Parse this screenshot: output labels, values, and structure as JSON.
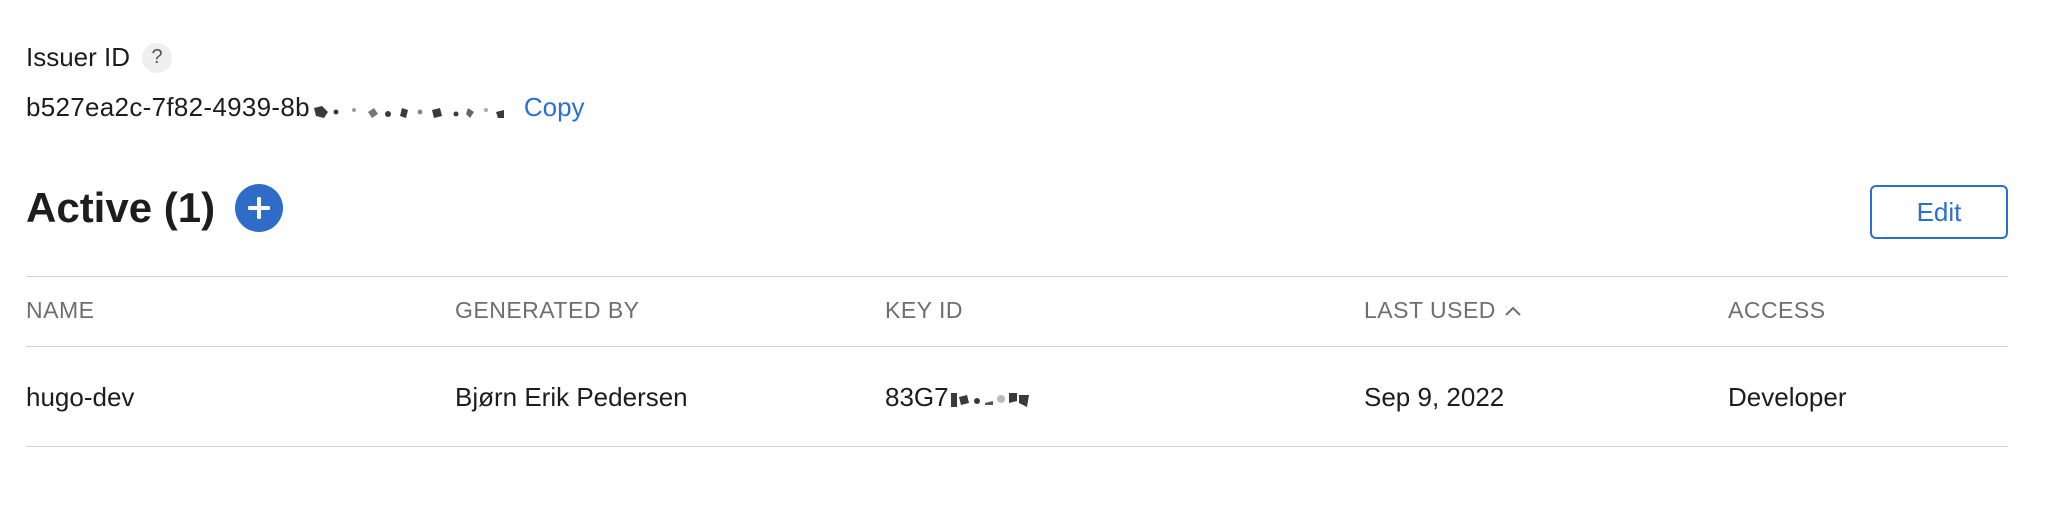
{
  "issuer": {
    "label": "Issuer ID",
    "help_symbol": "?",
    "value_visible": "b527ea2c-7f82-4939-8b",
    "copy_label": "Copy"
  },
  "keys_section": {
    "title": "Active (1)",
    "edit_label": "Edit"
  },
  "table": {
    "columns": {
      "name": "NAME",
      "generated_by": "GENERATED BY",
      "key_id": "KEY ID",
      "last_used": "LAST USED",
      "access": "ACCESS"
    },
    "rows": [
      {
        "name": "hugo-dev",
        "generated_by": "Bjørn Erik Pedersen",
        "key_id_visible": "83G7",
        "last_used": "Sep 9, 2022",
        "access": "Developer"
      }
    ]
  },
  "colors": {
    "accent": "#2a6fd1",
    "add_button": "#2e6cc7",
    "header_text": "#6e6e73",
    "rule": "#d2d2d2"
  },
  "icons": {
    "help": "question-mark-icon",
    "add": "plus-circle-icon",
    "sort": "chevron-up-icon"
  }
}
